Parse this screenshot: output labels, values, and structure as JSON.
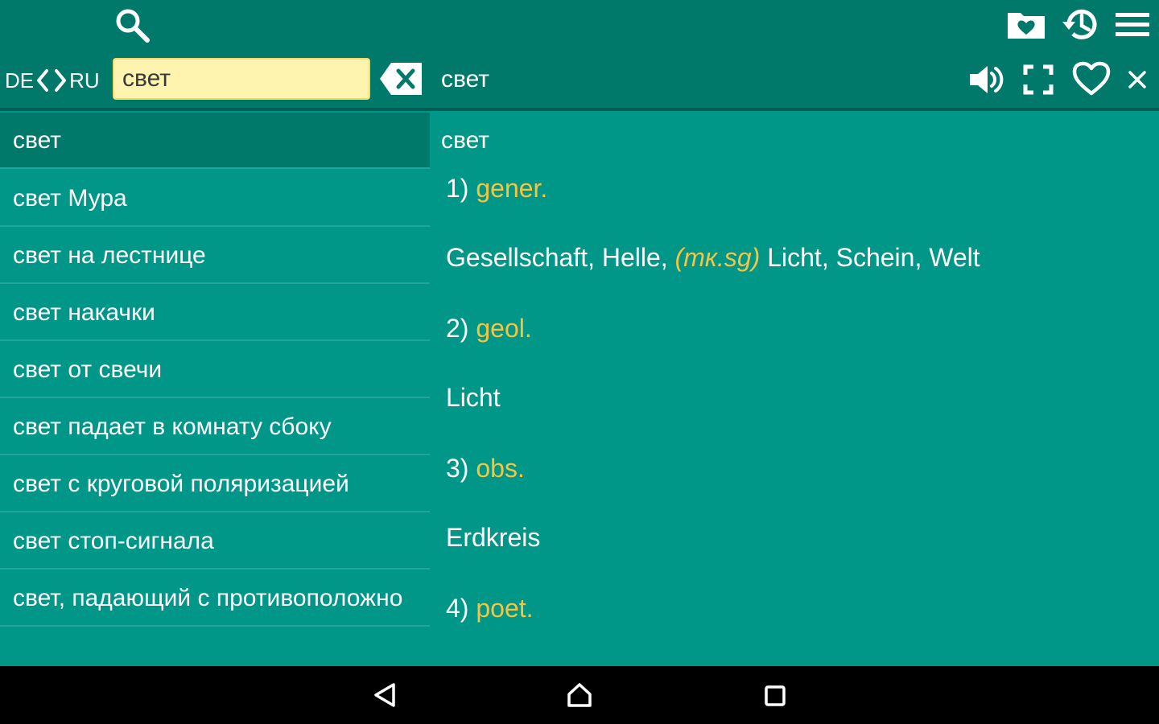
{
  "toolbar": {
    "icons": [
      "search-icon",
      "favorites-folder-icon",
      "history-icon",
      "menu-icon"
    ]
  },
  "search_row": {
    "source_lang": "DE",
    "target_lang": "RU",
    "query": "свет",
    "header_word": "свет",
    "icons": [
      "speaker-icon",
      "fullscreen-icon",
      "heart-icon",
      "close-icon"
    ]
  },
  "results": {
    "items": [
      "свет",
      "свет Мура",
      "свет на лестнице",
      "свет накачки",
      "свет от свечи",
      "свет падает в комнату сбоку",
      "свет с круговой поляризацией",
      "свет стоп-сигнала",
      "свет, падающий с противоположно"
    ],
    "selected_index": 0
  },
  "article": {
    "word": "свет",
    "senses": [
      {
        "num": "1)",
        "tag": "gener.",
        "text_before": "Gesellschaft, Helle, ",
        "note": "(тк.sg)",
        "text_after": " Licht, Schein, Welt"
      },
      {
        "num": "2)",
        "tag": "geol.",
        "text_before": "Licht",
        "note": "",
        "text_after": ""
      },
      {
        "num": "3)",
        "tag": "obs.",
        "text_before": "Erdkreis",
        "note": "",
        "text_after": ""
      },
      {
        "num": "4)",
        "tag": "poet.",
        "text_before": "",
        "note": "",
        "text_after": ""
      }
    ]
  },
  "navbar": {
    "icons": [
      "back-icon",
      "home-icon",
      "recents-icon"
    ]
  },
  "colors": {
    "topbar": "#00796b",
    "background": "#009688",
    "accent_tag": "#f5c542",
    "search_field": "#fff3b0"
  }
}
